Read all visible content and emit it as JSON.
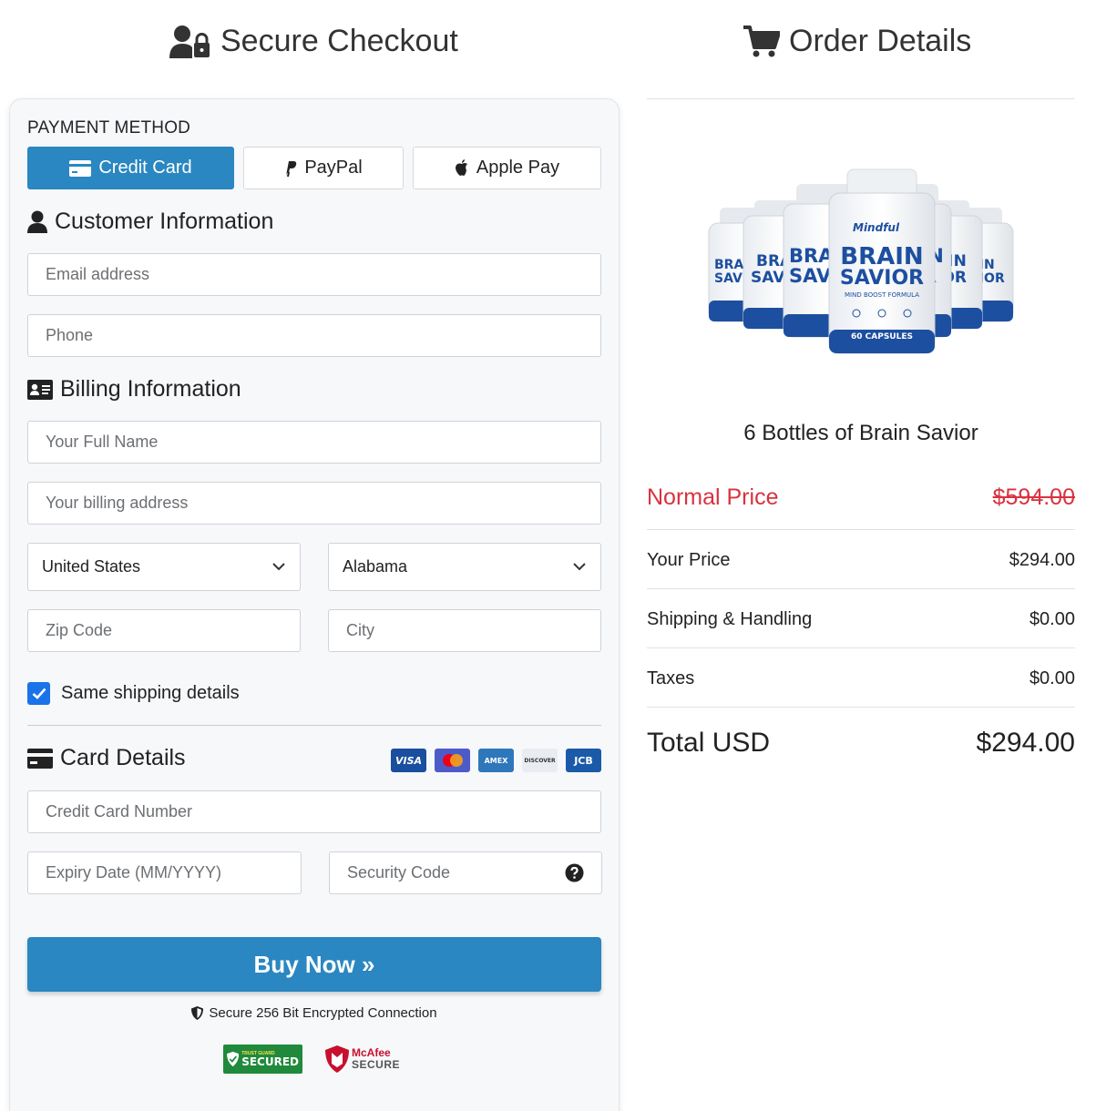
{
  "header": {
    "checkout_title": "Secure Checkout",
    "order_title": "Order Details"
  },
  "payment": {
    "label": "PAYMENT METHOD",
    "methods": [
      {
        "label": "Credit Card",
        "active": true
      },
      {
        "label": "PayPal",
        "active": false
      },
      {
        "label": "Apple Pay",
        "active": false
      }
    ]
  },
  "customer": {
    "title": "Customer Information",
    "email_placeholder": "Email address",
    "phone_placeholder": "Phone"
  },
  "billing": {
    "title": "Billing Information",
    "name_placeholder": "Your Full Name",
    "address_placeholder": "Your billing address",
    "country": "United States",
    "state": "Alabama",
    "zip_placeholder": "Zip Code",
    "city_placeholder": "City",
    "same_shipping_label": "Same shipping details",
    "same_shipping_checked": true
  },
  "card": {
    "title": "Card Details",
    "logos": [
      "VISA",
      "MC",
      "AMEX",
      "DISCOVER",
      "JCB"
    ],
    "number_placeholder": "Credit Card Number",
    "expiry_placeholder": "Expiry Date (MM/YYYY)",
    "cvc_placeholder": "Security Code"
  },
  "buy_button": "Buy Now »",
  "secure_text": "Secure 256 Bit Encrypted Connection",
  "badges": {
    "trust_top": "TRUST GUARD",
    "trust_main": "SECURED",
    "mcafee_top": "McAfee",
    "mcafee_main": "SECURE"
  },
  "product": {
    "bottle_brand": "Mindful",
    "bottle_name_1": "BRAIN",
    "bottle_name_2": "SAVIOR",
    "bottle_sub": "MIND BOOST FORMULA",
    "bottle_caps": "60 CAPSULES",
    "name": "6 Bottles of Brain Savior"
  },
  "order": {
    "normal_label": "Normal Price",
    "normal_value": "$594.00",
    "your_price_label": "Your Price",
    "your_price_value": "$294.00",
    "shipping_label": "Shipping & Handling",
    "shipping_value": "$0.00",
    "taxes_label": "Taxes",
    "taxes_value": "$0.00",
    "total_label": "Total USD",
    "total_value": "$294.00"
  },
  "colors": {
    "primary": "#2a87c1",
    "normal_price_red": "#d9323f",
    "checkbox_blue": "#1a73e8"
  }
}
